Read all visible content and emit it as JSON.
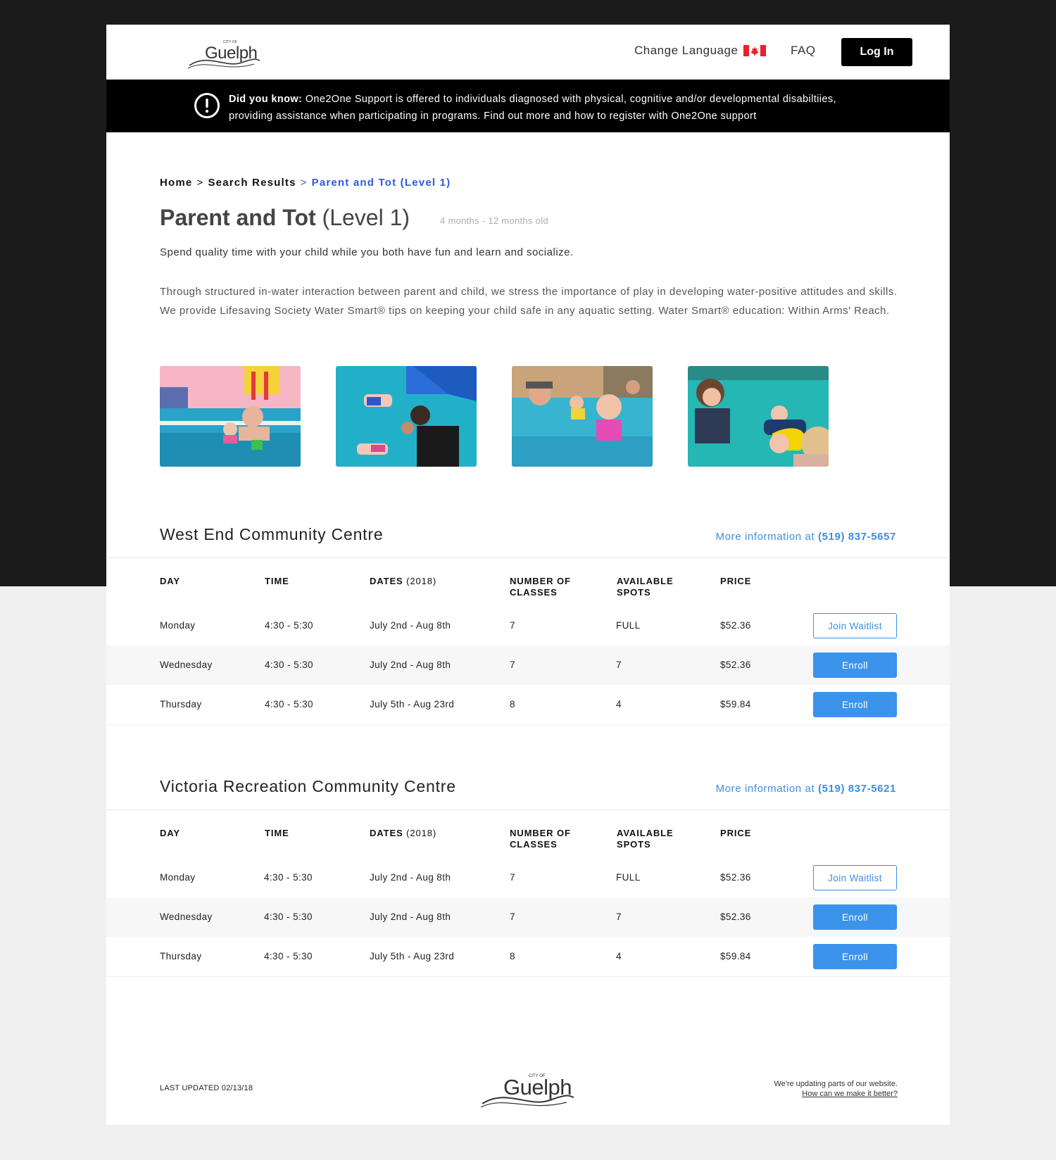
{
  "header": {
    "logo_small": "CITY OF",
    "logo_text": "Guelph",
    "change_language": "Change Language",
    "faq": "FAQ",
    "login": "Log In"
  },
  "alert": {
    "lead": "Did you know:",
    "text": " One2One Support is offered to individuals diagnosed with physical, cognitive and/or developmental disabiltiies, providing assistance when participating in programs. Find out more and how to register with One2One support"
  },
  "breadcrumb": {
    "home": "Home",
    "separator": ">",
    "search_results": "Search Results",
    "current": "Parent and Tot (Level 1)"
  },
  "program": {
    "title_main": "Parent and Tot",
    "title_level": "(Level 1)",
    "age_range": "4 months - 12 months old",
    "intro": "Spend quality time with your child while you both have fun and learn and socialize.",
    "description": "Through structured in-water interaction between parent and child, we stress the importance of play in developing water-positive attitudes and skills. We provide Lifesaving Society Water Smart® tips on keeping your child safe in any aquatic setting. Water Smart® education: Within Arms' Reach."
  },
  "table_headers": {
    "day": "DAY",
    "time": "TIME",
    "dates": "DATES",
    "dates_year": "(2018)",
    "classes_line1": "NUMBER OF",
    "classes_line2": "CLASSES",
    "spots_line1": "AVAILABLE",
    "spots_line2": "SPOTS",
    "price": "PRICE"
  },
  "locations": [
    {
      "name": "West End Community Centre",
      "more_info_label": "More information at",
      "phone": "(519) 837-5657",
      "sessions": [
        {
          "day": "Monday",
          "time": "4:30 - 5:30",
          "dates": "July 2nd - Aug 8th",
          "classes": "7",
          "spots": "FULL",
          "price": "$52.36",
          "action": "Join Waitlist"
        },
        {
          "day": "Wednesday",
          "time": "4:30 - 5:30",
          "dates": "July 2nd - Aug 8th",
          "classes": "7",
          "spots": "7",
          "price": "$52.36",
          "action": "Enroll"
        },
        {
          "day": "Thursday",
          "time": "4:30 - 5:30",
          "dates": "July 5th - Aug 23rd",
          "classes": "8",
          "spots": "4",
          "price": "$59.84",
          "action": "Enroll"
        }
      ]
    },
    {
      "name": "Victoria Recreation Community Centre",
      "more_info_label": "More information at",
      "phone": "(519) 837-5621",
      "sessions": [
        {
          "day": "Monday",
          "time": "4:30 - 5:30",
          "dates": "July 2nd - Aug 8th",
          "classes": "7",
          "spots": "FULL",
          "price": "$52.36",
          "action": "Join Waitlist"
        },
        {
          "day": "Wednesday",
          "time": "4:30 - 5:30",
          "dates": "July 2nd - Aug 8th",
          "classes": "7",
          "spots": "7",
          "price": "$52.36",
          "action": "Enroll"
        },
        {
          "day": "Thursday",
          "time": "4:30 - 5:30",
          "dates": "July 5th - Aug 23rd",
          "classes": "8",
          "spots": "4",
          "price": "$59.84",
          "action": "Enroll"
        }
      ]
    }
  ],
  "footer": {
    "last_updated": "LAST UPDATED 02/13/18",
    "notice": "We're updating parts of our website.",
    "feedback_link": "How can we make it better?"
  },
  "colors": {
    "accent_blue": "#3b93ea",
    "breadcrumb_blue": "#2f5ad8",
    "alert_bg": "#000000",
    "page_dark": "#1b1b1b"
  }
}
